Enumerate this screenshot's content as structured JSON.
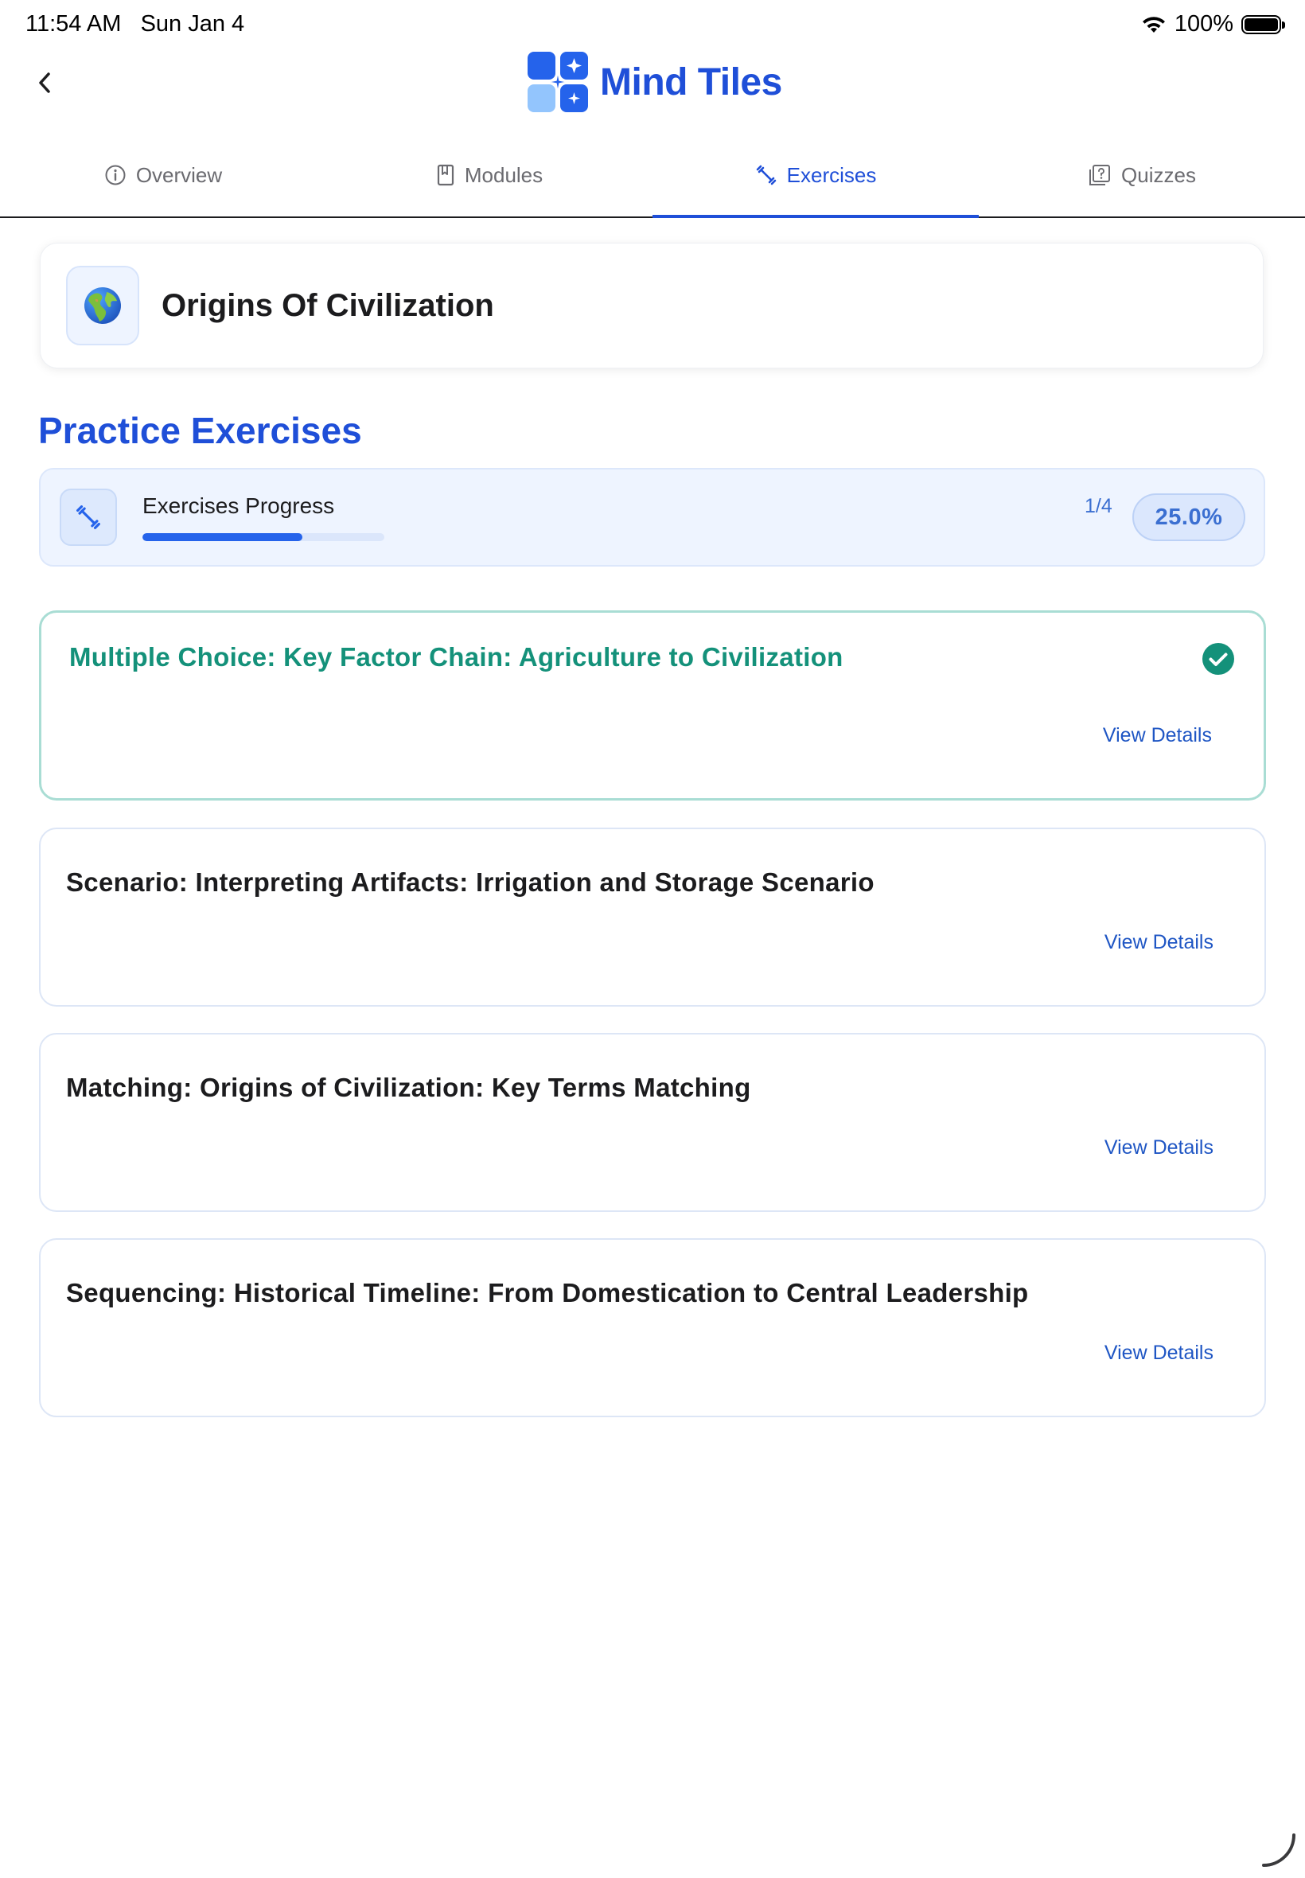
{
  "status_bar": {
    "time": "11:54 AM",
    "date": "Sun Jan 4",
    "battery": "100%"
  },
  "header": {
    "app_title": "Mind Tiles"
  },
  "tabs": [
    {
      "label": "Overview",
      "icon": "info-icon"
    },
    {
      "label": "Modules",
      "icon": "book-icon"
    },
    {
      "label": "Exercises",
      "icon": "exercise-icon",
      "active": true
    },
    {
      "label": "Quizzes",
      "icon": "quiz-icon"
    }
  ],
  "course": {
    "title": "Origins Of Civilization",
    "icon": "globe-icon"
  },
  "section": {
    "title": "Practice Exercises"
  },
  "progress": {
    "label": "Exercises Progress",
    "count": "1/4",
    "percent": "25.0%",
    "fraction": 0.25
  },
  "exercises": [
    {
      "title": "Multiple Choice: Key Factor Chain: Agriculture to Civilization",
      "action": "View Details",
      "completed": true
    },
    {
      "title": "Scenario: Interpreting Artifacts: Irrigation and Storage Scenario",
      "action": "View Details",
      "completed": false
    },
    {
      "title": "Matching: Origins of Civilization: Key Terms Matching",
      "action": "View Details",
      "completed": false
    },
    {
      "title": "Sequencing: Historical Timeline: From Domestication to Central Leadership",
      "action": "View Details",
      "completed": false
    }
  ],
  "colors": {
    "accent": "#1f4fd8",
    "completed": "#14917a",
    "completed_border": "#a9ddd4",
    "progress_bg": "#eef4ff"
  }
}
